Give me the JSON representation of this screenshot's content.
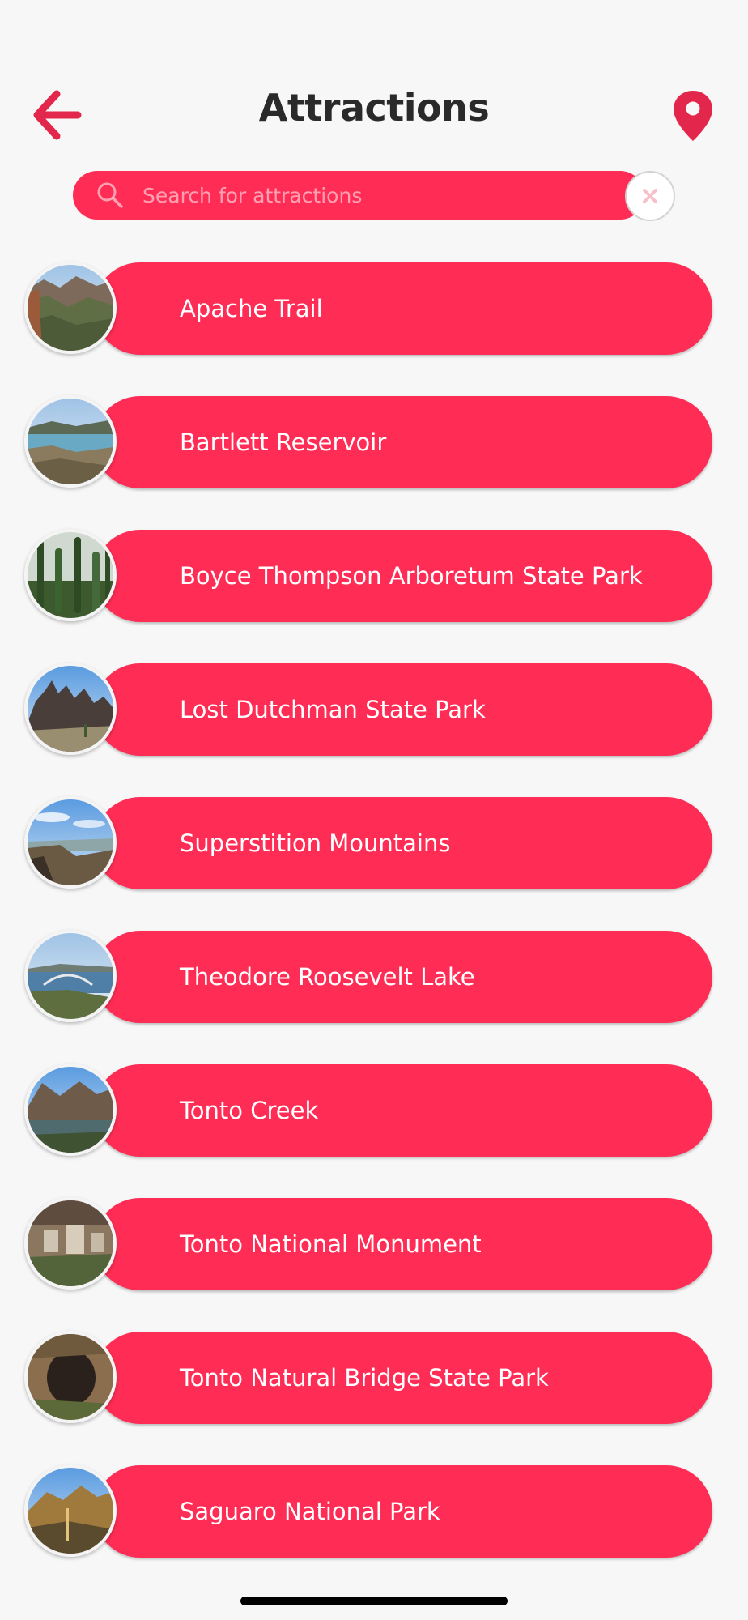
{
  "header": {
    "title": "Attractions",
    "back_icon": "back-arrow-icon",
    "map_icon": "map-pin-icon"
  },
  "search": {
    "placeholder": "Search for attractions",
    "value": "",
    "search_icon": "search-icon",
    "clear_icon": "clear-x-icon"
  },
  "colors": {
    "accent": "#ff2d55",
    "background": "#f7f7f7",
    "title": "#2a2a2a"
  },
  "attractions": [
    {
      "label": "Apache Trail"
    },
    {
      "label": "Bartlett Reservoir"
    },
    {
      "label": "Boyce Thompson Arboretum State Park"
    },
    {
      "label": "Lost Dutchman State Park"
    },
    {
      "label": "Superstition Mountains"
    },
    {
      "label": "Theodore Roosevelt Lake"
    },
    {
      "label": "Tonto Creek"
    },
    {
      "label": "Tonto National Monument"
    },
    {
      "label": "Tonto Natural Bridge State Park"
    },
    {
      "label": "Saguaro National Park"
    }
  ]
}
